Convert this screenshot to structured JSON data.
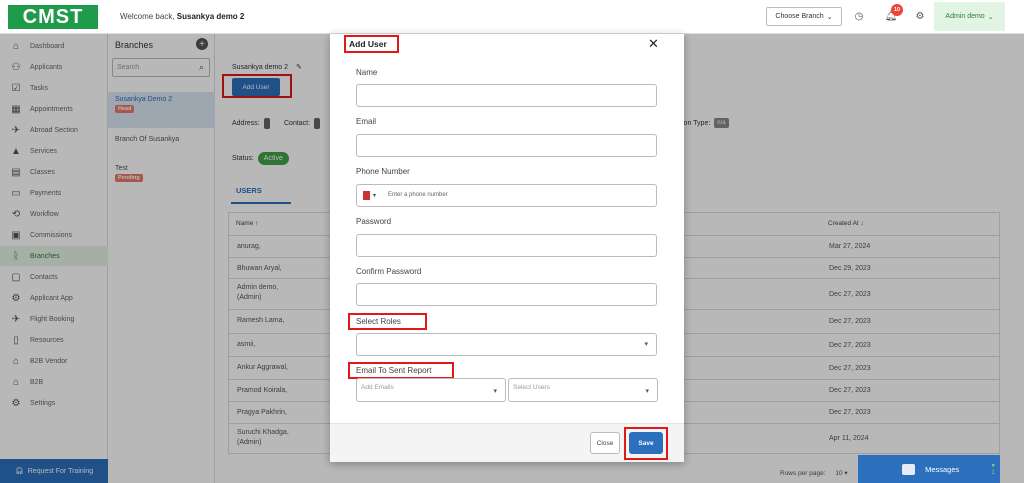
{
  "header": {
    "logo": "CMST",
    "welcome_prefix": "Welcome back,",
    "welcome_user": "Susankya demo 2",
    "choose_branch": "Choose Branch",
    "notification_count": "10",
    "admin_label": "Admin demo"
  },
  "sidebar": {
    "items": [
      {
        "label": "Dashboard",
        "icon": "home-icon"
      },
      {
        "label": "Applicants",
        "icon": "users-icon"
      },
      {
        "label": "Tasks",
        "icon": "tasks-icon"
      },
      {
        "label": "Appointments",
        "icon": "calendar-icon"
      },
      {
        "label": "Abroad Section",
        "icon": "plane-icon"
      },
      {
        "label": "Services",
        "icon": "services-icon"
      },
      {
        "label": "Classes",
        "icon": "book-icon"
      },
      {
        "label": "Payments",
        "icon": "payment-icon"
      },
      {
        "label": "Workflow",
        "icon": "workflow-icon"
      },
      {
        "label": "Commissions",
        "icon": "commission-icon"
      },
      {
        "label": "Branches",
        "icon": "branch-icon"
      },
      {
        "label": "Contacts",
        "icon": "contact-icon"
      },
      {
        "label": "Applicant App",
        "icon": "app-icon"
      },
      {
        "label": "Flight Booking",
        "icon": "flight-icon"
      },
      {
        "label": "Resources",
        "icon": "file-icon"
      },
      {
        "label": "B2B Vendor",
        "icon": "vendor-icon"
      },
      {
        "label": "B2B",
        "icon": "b2b-icon"
      },
      {
        "label": "Settings",
        "icon": "settings-icon"
      }
    ],
    "active_index": 10,
    "training_label": "Request For Training"
  },
  "branches_panel": {
    "title": "Branches",
    "search_placeholder": "Search",
    "items": [
      {
        "name": "Susankya Demo 2",
        "tag": "Head"
      },
      {
        "name": "Branch Of Susankya",
        "tag": ""
      },
      {
        "name": "Test",
        "tag": "Pending"
      }
    ]
  },
  "main": {
    "branch_name": "Susankya demo 2",
    "add_user_label": "Add User",
    "address_label": "Address:",
    "contact_label": "Contact:",
    "type_label": "ion Type:",
    "type_value": "n/a",
    "status_label": "Status:",
    "status_value": "Active",
    "tab_users": "USERS",
    "table": {
      "col_name": "Name",
      "col_created": "Created At",
      "rows": [
        {
          "name": "anurag,",
          "sub": "",
          "created": "Mar 27, 2024"
        },
        {
          "name": "Bhuwan Aryal,",
          "sub": "",
          "created": "Dec 29, 2023"
        },
        {
          "name": "Admin demo,",
          "sub": "(Admin)",
          "created": "Dec 27, 2023"
        },
        {
          "name": "Ramesh Lama,",
          "sub": "",
          "created": "Dec 27, 2023"
        },
        {
          "name": "asmii,",
          "sub": "",
          "created": "Dec 27, 2023"
        },
        {
          "name": "Ankur Aggrawal,",
          "sub": "",
          "created": "Dec 27, 2023"
        },
        {
          "name": "Pramod Koirala,",
          "sub": "",
          "created": "Dec 27, 2023"
        },
        {
          "name": "Pragya Pakhrin,",
          "sub": "",
          "created": "Dec 27, 2023"
        },
        {
          "name": "Suruchi Khadga,",
          "sub": "(Admin)",
          "created": "Apr 11, 2024"
        }
      ]
    },
    "rows_per_page_label": "Rows per page:",
    "rows_per_page_value": "10",
    "messages_label": "Messages",
    "messages_count": "1"
  },
  "modal": {
    "title": "Add User",
    "fields": {
      "name": "Name",
      "email": "Email",
      "phone": "Phone Number",
      "phone_placeholder": "Enter a phone number",
      "password": "Password",
      "confirm_password": "Confirm Password",
      "roles": "Select Roles",
      "email_report": "Email To Sent Report",
      "add_emails_placeholder": "Add Emails",
      "select_users_placeholder": "Select Users"
    },
    "close_label": "Close",
    "save_label": "Save"
  },
  "colors": {
    "brand_green": "#1e9a4a",
    "primary_blue": "#2c6fbd",
    "highlight_red": "#e01818"
  }
}
